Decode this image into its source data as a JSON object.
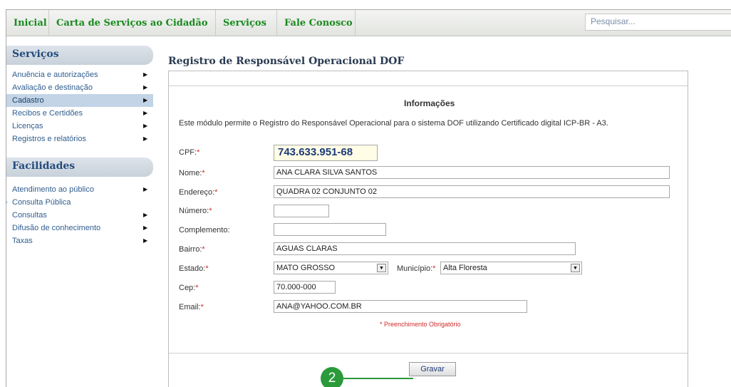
{
  "topnav": {
    "items": [
      "Inicial",
      "Carta de Serviços ao Cidadão",
      "Serviços",
      "Fale Conosco"
    ],
    "search_placeholder": "Pesquisar..."
  },
  "sidebar": {
    "services_title": "Serviços",
    "services": [
      {
        "label": "Anuência e autorizações"
      },
      {
        "label": "Avaliação e destinação"
      },
      {
        "label": "Cadastro"
      },
      {
        "label": "Recibos e Certidões"
      },
      {
        "label": "Licenças"
      },
      {
        "label": "Registros e relatórios"
      }
    ],
    "facilities_title": "Facilidades",
    "facilities": [
      {
        "label": "Atendimento ao público"
      },
      {
        "label": "Consulta Pública"
      },
      {
        "label": "Consultas"
      },
      {
        "label": "Difusão de conhecimento"
      },
      {
        "label": "Taxas"
      }
    ]
  },
  "main": {
    "title": "Registro de Responsável Operacional DOF",
    "info_title": "Informações",
    "info_text": "Este módulo permite o Registro do Responsável Operacional para o sistema DOF utilizando Certificado digital ICP-BR - A3.",
    "required_mark": "*",
    "required_note": "* Preenchimento Obrigatório",
    "save_label": "Gravar",
    "callout_number": "2"
  },
  "form": {
    "cpf": {
      "label": "CPF:",
      "value": "743.633.951-68"
    },
    "nome": {
      "label": "Nome:",
      "value": "ANA CLARA SILVA SANTOS"
    },
    "endereco": {
      "label": "Endereço:",
      "value": "QUADRA 02 CONJUNTO 02"
    },
    "numero": {
      "label": "Número:",
      "value": ""
    },
    "complemento": {
      "label": "Complemento:",
      "value": ""
    },
    "bairro": {
      "label": "Bairro:",
      "value": "AGUAS CLARAS"
    },
    "estado": {
      "label": "Estado:",
      "value": "MATO GROSSO"
    },
    "municipio": {
      "label": "Município:",
      "value": "Alta Floresta"
    },
    "cep": {
      "label": "Cep:",
      "value": "70.000-000"
    },
    "email": {
      "label": "Email:",
      "value": "ANA@YAHOO.COM.BR"
    }
  },
  "colors": {
    "nav_green": "#1a8a1f",
    "callout_green": "#2a9a3a",
    "required_red": "#d12a2a",
    "active_item": "#c2d4e6"
  }
}
